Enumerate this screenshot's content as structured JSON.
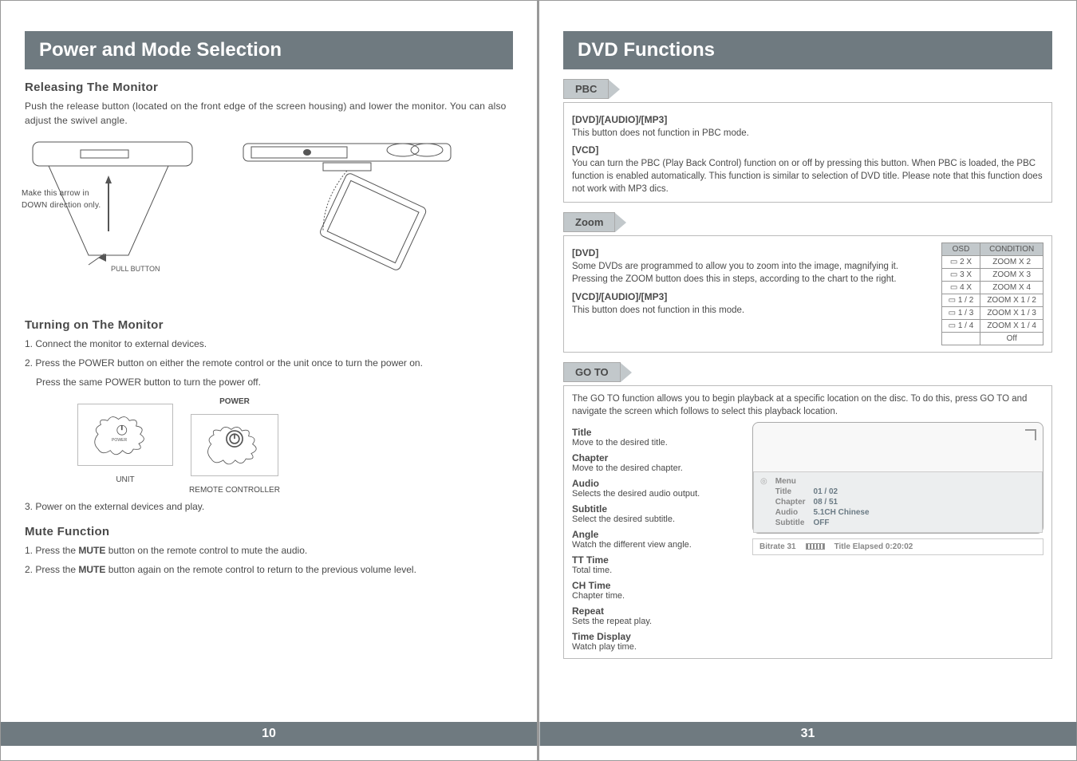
{
  "left": {
    "title": "Power and Mode Selection",
    "releasing_h": "Releasing The Monitor",
    "releasing_body": "Push the release button (located on the front edge of the screen housing) and lower the monitor. You can also adjust the swivel angle.",
    "arrow_note": "Make this arrow in DOWN direction only.",
    "pull_button": "PULL BUTTON",
    "turning_h": "Turning on The Monitor",
    "step1": "1. Connect the monitor to external devices.",
    "step2a": "2. Press the POWER button on either the remote control or the unit once to turn the power on.",
    "step2b": "Press the same POWER button to turn the power off.",
    "power_label": "POWER",
    "unit_caption": "UNIT",
    "remote_caption": "REMOTE CONTROLLER",
    "step3": "3. Power on the external devices and play.",
    "mute_h": "Mute Function",
    "mute1a": "1. Press the ",
    "mute1b": "MUTE",
    "mute1c": " button on the remote control to mute the audio.",
    "mute2a": "2. Press the ",
    "mute2b": "MUTE",
    "mute2c": " button again on the remote control to return to the previous volume level.",
    "page_no": "10"
  },
  "right": {
    "title": "DVD Functions",
    "pbc_h": "PBC",
    "pbc_sub1": "[DVD]/[AUDIO]/[MP3]",
    "pbc_sub1_body": "This button does not function in PBC mode.",
    "pbc_sub2": "[VCD]",
    "pbc_sub2_body": "You can turn the PBC (Play Back Control) function on or off by pressing this button. When PBC is loaded, the PBC function is enabled automatically. This function is similar to selection of DVD title. Please note that this function does not work with MP3 dics.",
    "zoom_h": "Zoom",
    "zoom_sub1": "[DVD]",
    "zoom_sub1_body": "Some DVDs are programmed to allow you to zoom into the image, magnifying it. Pressing the ZOOM button does this in steps, according to the chart to the right.",
    "zoom_sub2": "[VCD]/[AUDIO]/[MP3]",
    "zoom_sub2_body": "This button does not function in this mode.",
    "zoom_table_head": {
      "osd": "OSD",
      "cond": "CONDITION"
    },
    "chart_data": {
      "type": "table",
      "columns": [
        "OSD",
        "CONDITION"
      ],
      "rows": [
        [
          "2 X",
          "ZOOM X 2"
        ],
        [
          "3 X",
          "ZOOM X 3"
        ],
        [
          "4 X",
          "ZOOM X 4"
        ],
        [
          "1 / 2",
          "ZOOM X 1 / 2"
        ],
        [
          "1 / 3",
          "ZOOM X 1 / 3"
        ],
        [
          "1 / 4",
          "ZOOM X 1 / 4"
        ],
        [
          "",
          "Off"
        ]
      ]
    },
    "goto_h": "GO TO",
    "goto_intro": "The GO TO function allows you to begin playback at a specific location on the disc. To do this, press GO TO and navigate the screen which follows to select this playback location.",
    "goto_items": [
      {
        "t": "Title",
        "d": "Move to the desired title."
      },
      {
        "t": "Chapter",
        "d": "Move to the desired chapter."
      },
      {
        "t": "Audio",
        "d": "Selects the desired audio output."
      },
      {
        "t": "Subtitle",
        "d": "Select the desired subtitle."
      },
      {
        "t": "Angle",
        "d": "Watch the different view angle."
      },
      {
        "t": "TT Time",
        "d": "Total time."
      },
      {
        "t": "CH Time",
        "d": "Chapter time."
      },
      {
        "t": "Repeat",
        "d": "Sets the repeat play."
      },
      {
        "t": "Time Display",
        "d": "Watch play time."
      }
    ],
    "osd": {
      "menu": "Menu",
      "title_l": "Title",
      "title_v": "01 / 02",
      "chapter_l": "Chapter",
      "chapter_v": "08 / 51",
      "audio_l": "Audio",
      "audio_v": "5.1CH Chinese",
      "subtitle_l": "Subtitle",
      "subtitle_v": "OFF",
      "bitrate_l": "Bitrate 31",
      "elapsed": "Title Elapsed 0:20:02"
    },
    "page_no": "31"
  }
}
